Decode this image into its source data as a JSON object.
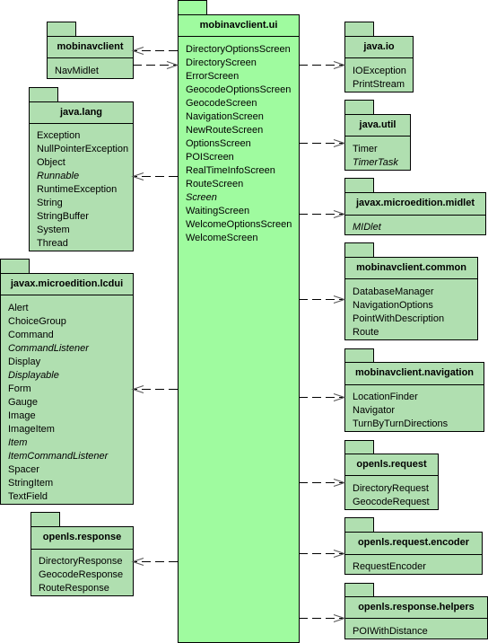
{
  "colors": {
    "package_fill": "#b0dfb0",
    "main_package_fill": "#9ffb9f",
    "border": "#000000",
    "arrow": "#000000"
  },
  "packages": [
    {
      "name": "mobinavclient.ui",
      "main": true,
      "classes": [
        {
          "name": "DirectoryOptionsScreen"
        },
        {
          "name": "DirectoryScreen"
        },
        {
          "name": "ErrorScreen"
        },
        {
          "name": "GeocodeOptionsScreen"
        },
        {
          "name": "GeocodeScreen"
        },
        {
          "name": "NavigationScreen"
        },
        {
          "name": "NewRouteScreen"
        },
        {
          "name": "OptionsScreen"
        },
        {
          "name": "POIScreen"
        },
        {
          "name": "RealTimeInfoScreen"
        },
        {
          "name": "RouteScreen"
        },
        {
          "name": "Screen",
          "abstract": true
        },
        {
          "name": "WaitingScreen"
        },
        {
          "name": "WelcomeOptionsScreen"
        },
        {
          "name": "WelcomeScreen"
        }
      ]
    },
    {
      "name": "mobinavclient",
      "classes": [
        {
          "name": "NavMidlet"
        }
      ]
    },
    {
      "name": "java.lang",
      "classes": [
        {
          "name": "Exception"
        },
        {
          "name": "NullPointerException"
        },
        {
          "name": "Object"
        },
        {
          "name": "Runnable",
          "abstract": true
        },
        {
          "name": "RuntimeException"
        },
        {
          "name": "String"
        },
        {
          "name": "StringBuffer"
        },
        {
          "name": "System"
        },
        {
          "name": "Thread"
        }
      ]
    },
    {
      "name": "javax.microedition.lcdui",
      "classes": [
        {
          "name": "Alert"
        },
        {
          "name": "ChoiceGroup"
        },
        {
          "name": "Command"
        },
        {
          "name": "CommandListener",
          "abstract": true
        },
        {
          "name": "Display"
        },
        {
          "name": "Displayable",
          "abstract": true
        },
        {
          "name": "Form"
        },
        {
          "name": "Gauge"
        },
        {
          "name": "Image"
        },
        {
          "name": "ImageItem"
        },
        {
          "name": "Item",
          "abstract": true
        },
        {
          "name": "ItemCommandListener",
          "abstract": true
        },
        {
          "name": "Spacer"
        },
        {
          "name": "StringItem"
        },
        {
          "name": "TextField"
        }
      ]
    },
    {
      "name": "openls.response",
      "classes": [
        {
          "name": "DirectoryResponse"
        },
        {
          "name": "GeocodeResponse"
        },
        {
          "name": "RouteResponse"
        }
      ]
    },
    {
      "name": "java.io",
      "classes": [
        {
          "name": "IOException"
        },
        {
          "name": "PrintStream"
        }
      ]
    },
    {
      "name": "java.util",
      "classes": [
        {
          "name": "Timer"
        },
        {
          "name": "TimerTask",
          "abstract": true
        }
      ]
    },
    {
      "name": "javax.microedition.midlet",
      "classes": [
        {
          "name": "MIDlet",
          "abstract": true
        }
      ]
    },
    {
      "name": "mobinavclient.common",
      "classes": [
        {
          "name": "DatabaseManager"
        },
        {
          "name": "NavigationOptions"
        },
        {
          "name": "PointWithDescription"
        },
        {
          "name": "Route"
        }
      ]
    },
    {
      "name": "mobinavclient.navigation",
      "classes": [
        {
          "name": "LocationFinder"
        },
        {
          "name": "Navigator"
        },
        {
          "name": "TurnByTurnDirections"
        }
      ]
    },
    {
      "name": "openls.request",
      "classes": [
        {
          "name": "DirectoryRequest"
        },
        {
          "name": "GeocodeRequest"
        }
      ]
    },
    {
      "name": "openls.request.encoder",
      "classes": [
        {
          "name": "RequestEncoder"
        }
      ]
    },
    {
      "name": "openls.response.helpers",
      "classes": [
        {
          "name": "POIWithDistance"
        }
      ]
    }
  ],
  "dependencies": [
    {
      "from": "mobinavclient.ui",
      "to": "mobinavclient"
    },
    {
      "from": "mobinavclient",
      "to": "mobinavclient.ui"
    },
    {
      "from": "mobinavclient.ui",
      "to": "java.lang"
    },
    {
      "from": "mobinavclient.ui",
      "to": "javax.microedition.lcdui"
    },
    {
      "from": "mobinavclient.ui",
      "to": "openls.response"
    },
    {
      "from": "mobinavclient.ui",
      "to": "java.io"
    },
    {
      "from": "mobinavclient.ui",
      "to": "java.util"
    },
    {
      "from": "mobinavclient.ui",
      "to": "javax.microedition.midlet"
    },
    {
      "from": "mobinavclient.ui",
      "to": "mobinavclient.common"
    },
    {
      "from": "mobinavclient.ui",
      "to": "mobinavclient.navigation"
    },
    {
      "from": "mobinavclient.ui",
      "to": "openls.request"
    },
    {
      "from": "mobinavclient.ui",
      "to": "openls.request.encoder"
    },
    {
      "from": "mobinavclient.ui",
      "to": "openls.response.helpers"
    }
  ]
}
